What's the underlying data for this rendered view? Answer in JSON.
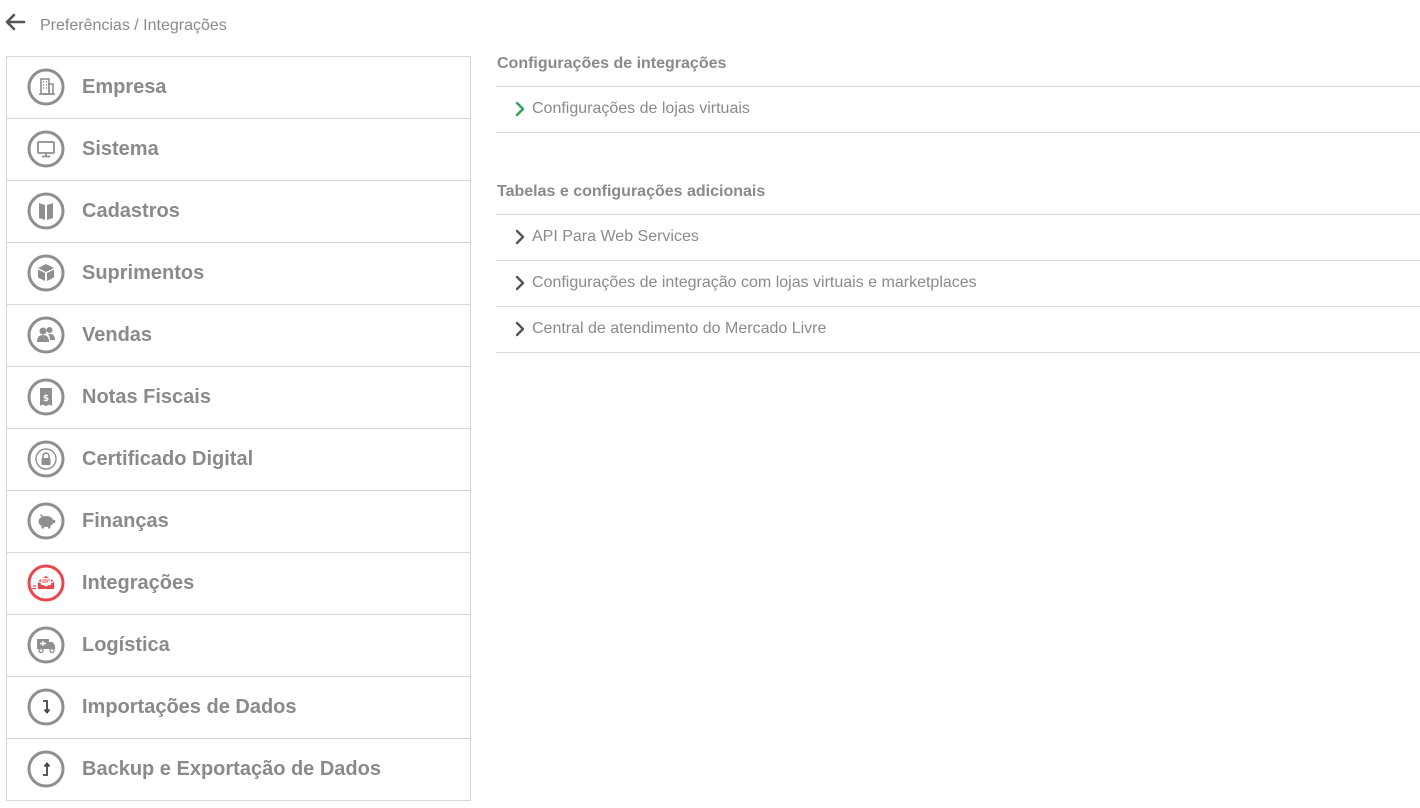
{
  "breadcrumb": {
    "text": "Preferências / Integrações"
  },
  "sidebar": {
    "items": [
      {
        "label": "Empresa",
        "icon": "building-icon",
        "active": false
      },
      {
        "label": "Sistema",
        "icon": "monitor-icon",
        "active": false
      },
      {
        "label": "Cadastros",
        "icon": "book-icon",
        "active": false
      },
      {
        "label": "Suprimentos",
        "icon": "box-icon",
        "active": false
      },
      {
        "label": "Vendas",
        "icon": "users-icon",
        "active": false
      },
      {
        "label": "Notas Fiscais",
        "icon": "receipt-icon",
        "active": false
      },
      {
        "label": "Certificado Digital",
        "icon": "lock-icon",
        "active": false
      },
      {
        "label": "Finanças",
        "icon": "piggy-bank-icon",
        "active": false
      },
      {
        "label": "Integrações",
        "icon": "envelope-icon",
        "active": true
      },
      {
        "label": "Logística",
        "icon": "truck-icon",
        "active": false
      },
      {
        "label": "Importações de Dados",
        "icon": "import-icon",
        "active": false
      },
      {
        "label": "Backup e Exportação de Dados",
        "icon": "export-icon",
        "active": false
      }
    ]
  },
  "content": {
    "section1": {
      "title": "Configurações de integrações",
      "links": [
        {
          "label": "Configurações de lojas virtuais",
          "chevron_color": "#2ea35b"
        }
      ]
    },
    "section2": {
      "title": "Tabelas e configurações adicionais",
      "links": [
        {
          "label": "API Para Web Services",
          "chevron_color": "#555555"
        },
        {
          "label": "Configurações de integração com lojas virtuais e marketplaces",
          "chevron_color": "#555555"
        },
        {
          "label": "Central de atendimento do Mercado Livre",
          "chevron_color": "#555555"
        }
      ]
    }
  },
  "colors": {
    "icon_gray": "#8f8f8f",
    "active_red": "#e8474d",
    "accent_green": "#2ea35b"
  }
}
